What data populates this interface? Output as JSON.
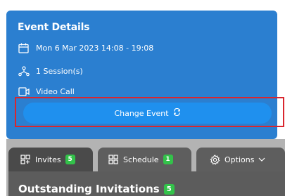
{
  "event": {
    "title": "Event Details",
    "datetime": "Mon 6 Mar 2023 14:08 - 19:08",
    "sessions": "1 Session(s)",
    "call_type": "Video Call",
    "change_button": "Change Event"
  },
  "icons": {
    "calendar": "calendar-icon",
    "sessions": "sessions-icon",
    "video": "video-call-icon",
    "refresh": "refresh-icon",
    "invites": "invites-icon",
    "schedule": "schedule-icon",
    "options": "gear-icon",
    "chevron": "chevron-down-icon"
  },
  "tabs": [
    {
      "label": "Invites",
      "count": "5"
    },
    {
      "label": "Schedule",
      "count": "1"
    },
    {
      "label": "Options"
    }
  ],
  "section": {
    "title": "Outstanding Invitations",
    "count": "5"
  },
  "colors": {
    "card": "#2b7fd0",
    "button": "#1f90ee",
    "highlight": "#d9262e",
    "badge": "#33c24a"
  }
}
